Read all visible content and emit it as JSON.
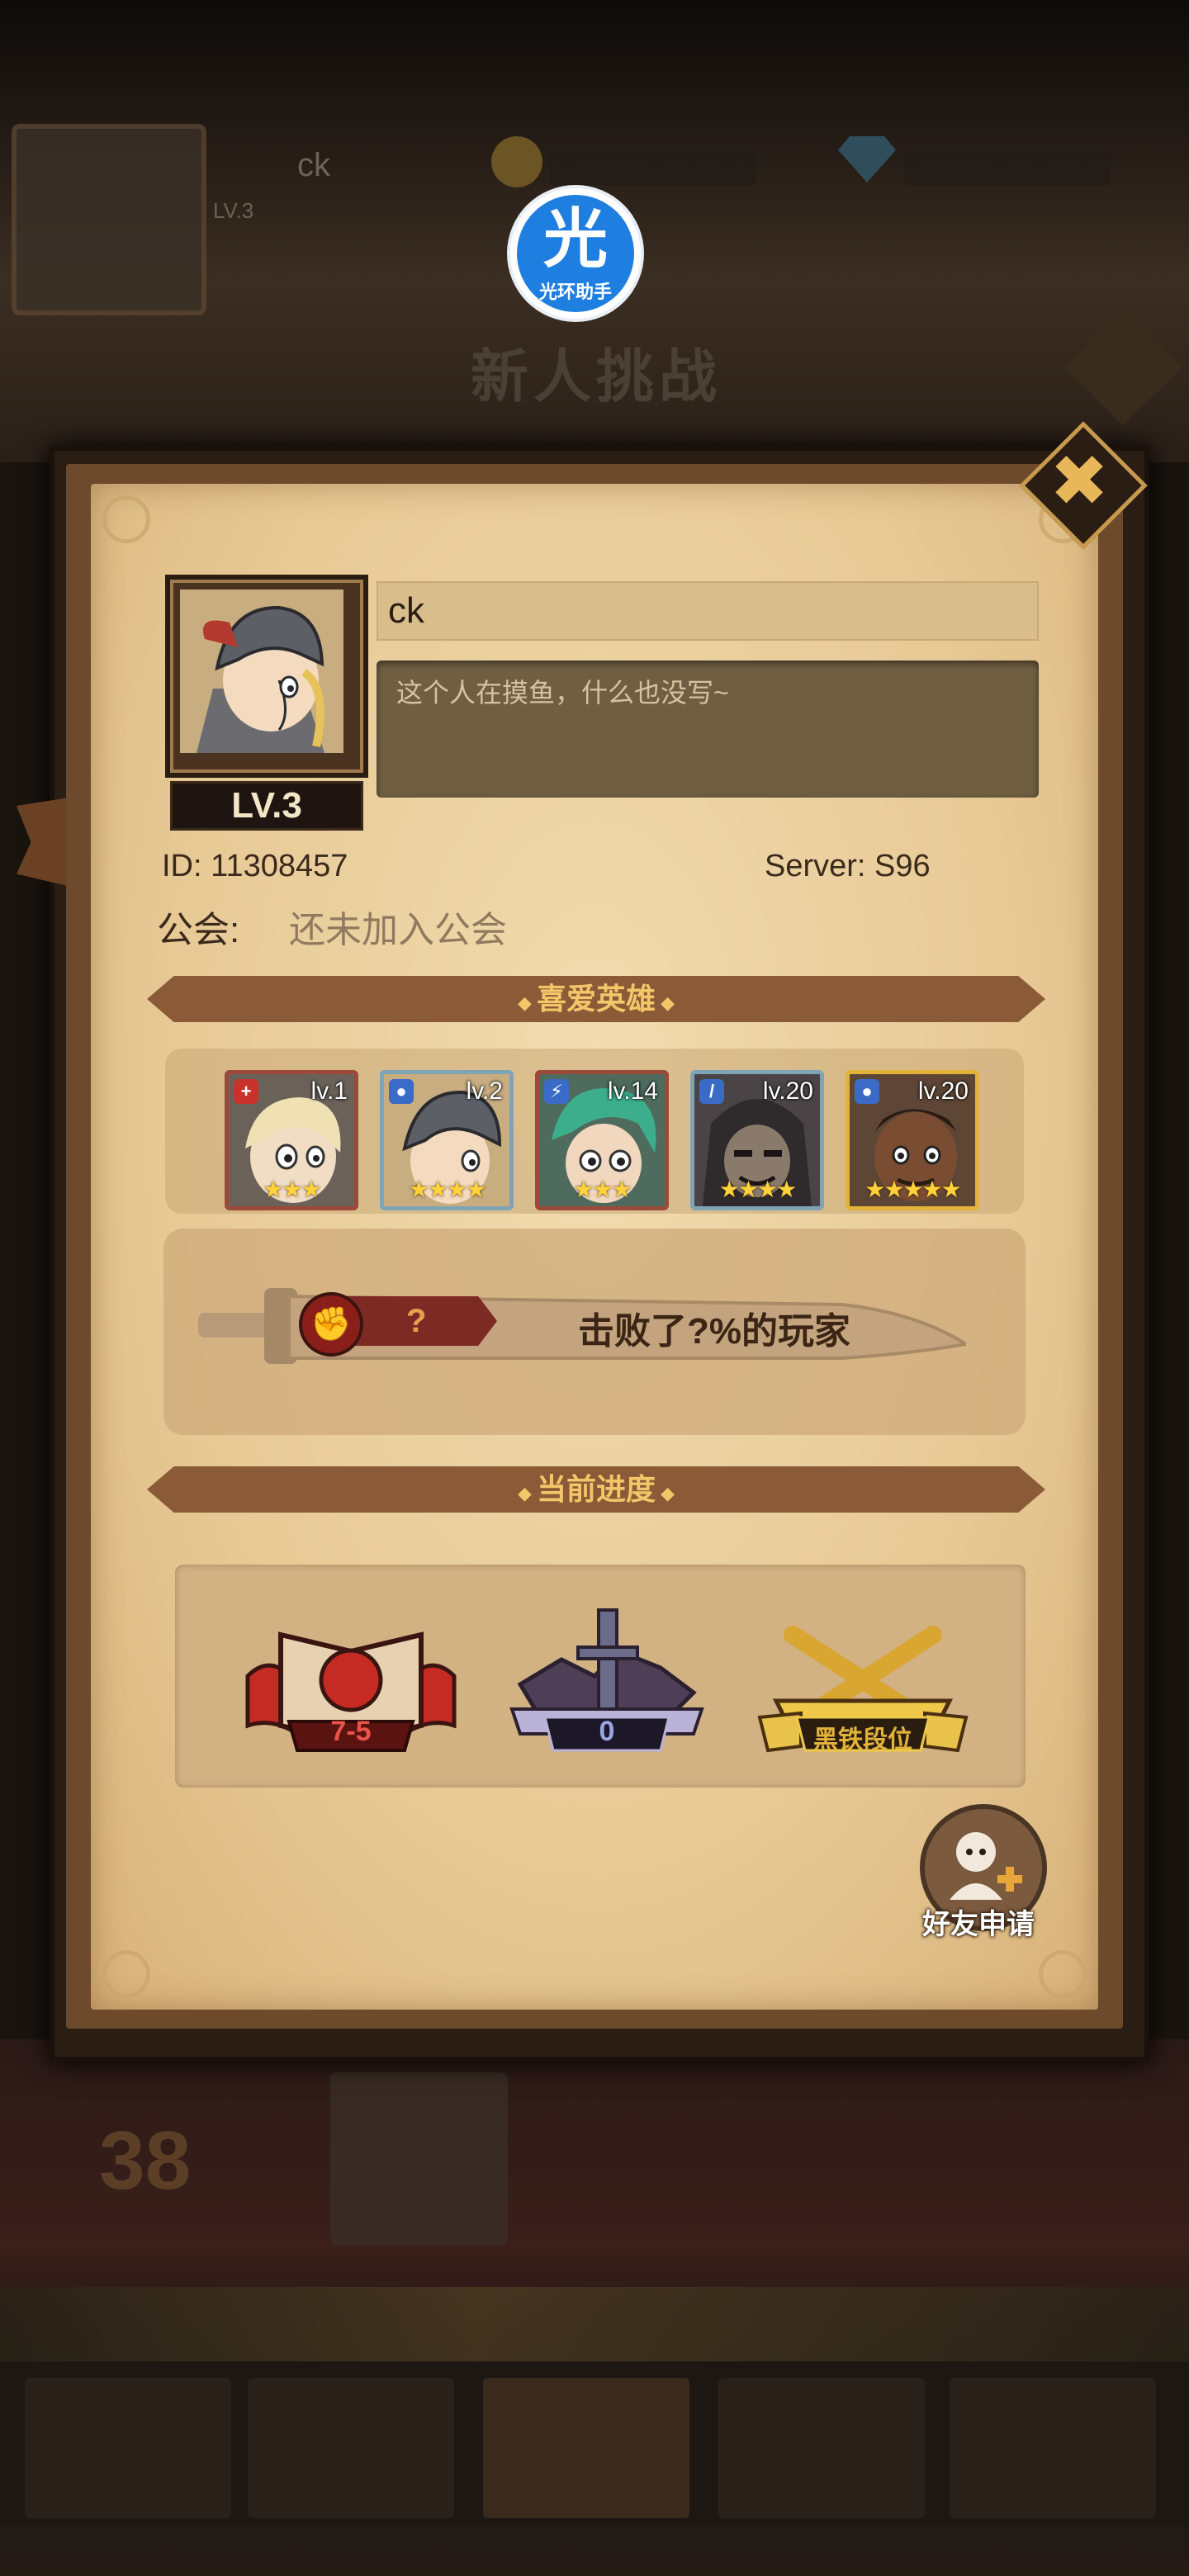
{
  "overlay": {
    "helper_badge_glyph": "光",
    "helper_badge_label": "光环助手"
  },
  "background": {
    "title": "新人挑战",
    "player_name": "ck",
    "level": "LV.3",
    "rank_number": "38",
    "rank_name": "ck"
  },
  "profile": {
    "level": "LV.3",
    "name": "ck",
    "signature": "这个人在摸鱼，什么也没写~",
    "id_label": "ID:",
    "id_value": "11308457",
    "server_label": "Server:",
    "server_value": "S96",
    "guild_label": "公会:",
    "guild_value": "还未加入公会"
  },
  "favorite_heroes": {
    "title": "喜爱英雄",
    "heroes": [
      {
        "level": "lv.1",
        "stars": 3,
        "stars_text": "★★★",
        "element_color": "#c8322b",
        "frame_color": "#9b4a3a"
      },
      {
        "level": "lv.2",
        "stars": 4,
        "stars_text": "★★★★",
        "element_color": "#3a6bc7",
        "frame_color": "#7fa4b6"
      },
      {
        "level": "lv.14",
        "stars": 3,
        "stars_text": "★★★",
        "element_color": "#3a6bc7",
        "frame_color": "#9b4a3a"
      },
      {
        "level": "lv.20",
        "stars": 4,
        "stars_text": "★★★★",
        "element_color": "#3a6bc7",
        "frame_color": "#7fa4b6"
      },
      {
        "level": "lv.20",
        "stars": 5,
        "stars_text": "★★★★★",
        "element_color": "#3a6bc7",
        "frame_color": "#e2b23a"
      }
    ]
  },
  "battle_stat": {
    "rank_value": "?",
    "defeat_text": "击败了?%的玩家"
  },
  "progress": {
    "title": "当前进度",
    "items": [
      {
        "icon": "stage-book-icon",
        "label": "7-5"
      },
      {
        "icon": "tower-sword-icon",
        "label": "0"
      },
      {
        "icon": "arena-crossed-swords-icon",
        "label": "黑铁段位"
      }
    ]
  },
  "actions": {
    "friend_request": "好友申请",
    "close": "✖"
  },
  "colors": {
    "parchment": "#e7c995",
    "banner": "#8b5a36",
    "banner_text": "#f3c66a",
    "accent_gold": "#e8b75a"
  }
}
